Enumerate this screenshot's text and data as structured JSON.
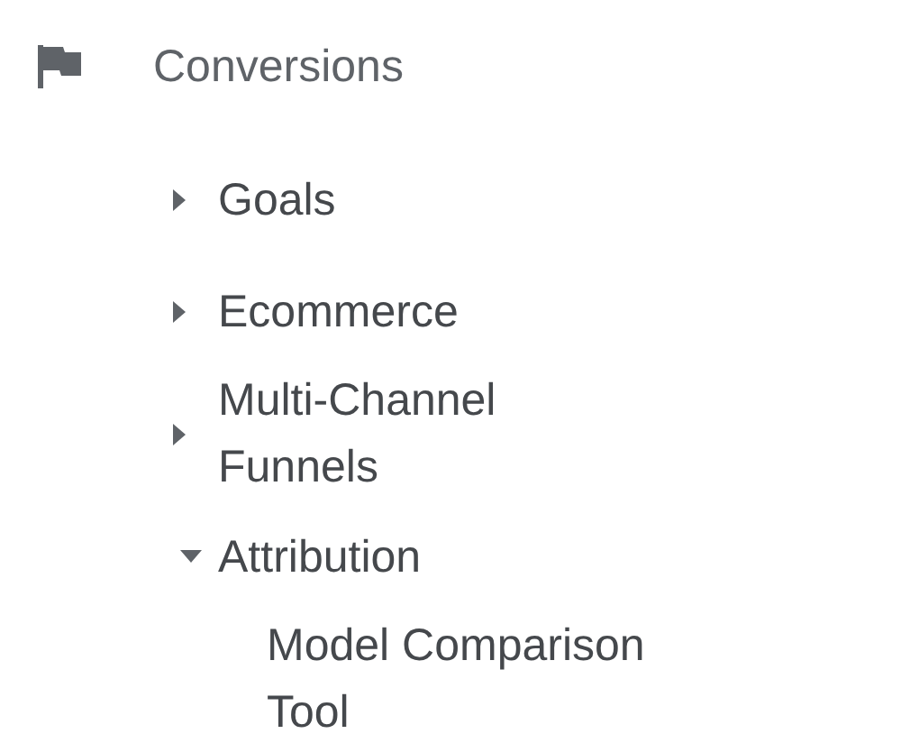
{
  "section": {
    "title": "Conversions"
  },
  "items": [
    {
      "label": "Goals",
      "expanded": false
    },
    {
      "label": "Ecommerce",
      "expanded": false
    },
    {
      "label": "Multi-Channel Funnels",
      "expanded": false
    },
    {
      "label": "Attribution",
      "expanded": true,
      "children": [
        {
          "label": "Model Comparison Tool"
        }
      ]
    }
  ]
}
